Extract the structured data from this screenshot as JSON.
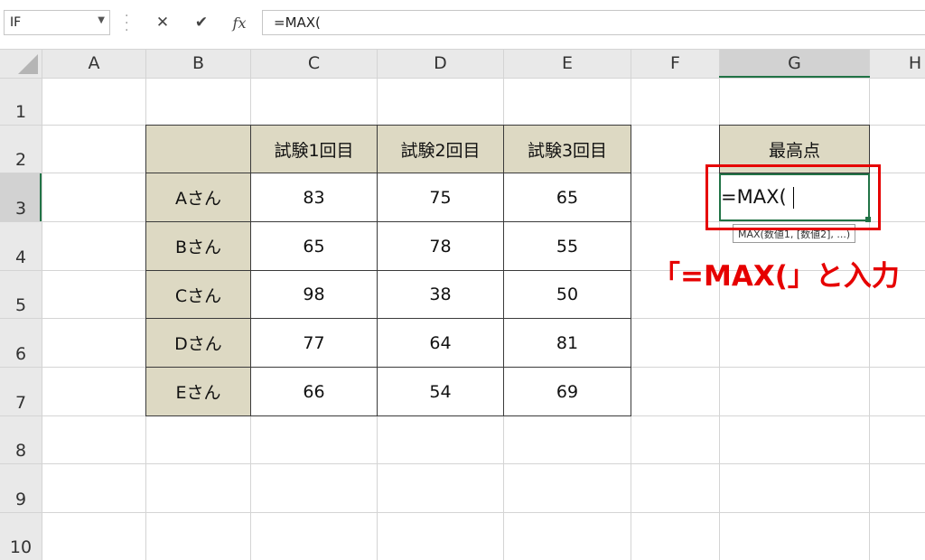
{
  "formula_bar": {
    "name_box": "IF",
    "cancel_icon": "✕",
    "enter_icon": "✔",
    "fx_label": "fx",
    "formula": "=MAX("
  },
  "columns": [
    "A",
    "B",
    "C",
    "D",
    "E",
    "F",
    "G",
    "H"
  ],
  "rows": [
    "1",
    "2",
    "3",
    "4",
    "5",
    "6",
    "7",
    "8",
    "9",
    "10"
  ],
  "table": {
    "headers": [
      "",
      "試験1回目",
      "試験2回目",
      "試験3回目"
    ],
    "rows": [
      {
        "name": "Aさん",
        "values": [
          "83",
          "75",
          "65"
        ]
      },
      {
        "name": "Bさん",
        "values": [
          "65",
          "78",
          "55"
        ]
      },
      {
        "name": "Cさん",
        "values": [
          "98",
          "38",
          "50"
        ]
      },
      {
        "name": "Dさん",
        "values": [
          "77",
          "64",
          "81"
        ]
      },
      {
        "name": "Eさん",
        "values": [
          "66",
          "54",
          "69"
        ]
      }
    ]
  },
  "result": {
    "header": "最高点",
    "editing_value": "=MAX(",
    "tooltip": "MAX(数値1, [数値2], ...)"
  },
  "annotation": {
    "text": "「=MAX(」と入力"
  },
  "colors": {
    "header_fill": "#ddd9c3",
    "active_cell_border": "#217346",
    "annotation": "#e60000"
  }
}
